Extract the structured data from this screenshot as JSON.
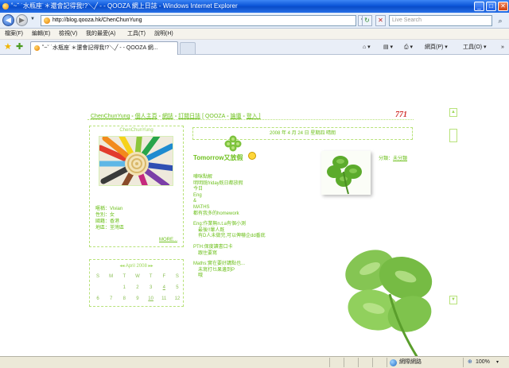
{
  "window": {
    "title": "˚~ˇ ˙水瓶座˙＊還會記得我!?＼╱ - - QOOZA 網上日誌 - Windows Internet Explorer",
    "minimize": "_",
    "maximize": "□",
    "close": "✕"
  },
  "addressbar": {
    "back_glyph": "◀",
    "forward_glyph": "▶",
    "url": "http://blog.qooza.hk/ChenChunYung",
    "dropdown_glyph": "▼",
    "refresh_glyph": "↻",
    "stop_glyph": "✕",
    "search_placeholder": "Live Search",
    "search_glyph": "⌕"
  },
  "menubar": {
    "items": [
      "檔案(F)",
      "編輯(E)",
      "檢視(V)",
      "我的最愛(A)",
      "工具(T)",
      "說明(H)"
    ]
  },
  "tabbar": {
    "active_tab": "˚~ˇ ˙水瓶座˙＊還會記得我!?＼╱ - - QOOZA 網...",
    "tools": {
      "home": "⌂ ▾",
      "feeds": "▤ ▾",
      "print": "⎙ ▾",
      "page": "網頁(P) ▾",
      "tools": "工具(O) ▾",
      "more": "»"
    }
  },
  "blog": {
    "nav": {
      "owner": "ChenChunYung",
      "sep": " - ",
      "home": "個人主頁",
      "diary": "網誌",
      "subscribe": "訂閱日誌",
      "qooza": "[ QOOZA",
      "forum": "論壇",
      "login": "登入 ]"
    },
    "visitor_count": "771",
    "scroll_up": "▲",
    "scroll_down": "▼",
    "profile": {
      "name": "ChenChunYung",
      "info": [
        "暱稱：Vivian",
        "性別：女",
        "國籍：香港",
        "地區：荃灣區"
      ],
      "more": "MORE..."
    },
    "calendar": {
      "title": "◂◂  April 2008  ▸▸",
      "weekdays": [
        "S",
        "M",
        "T",
        "W",
        "T",
        "F",
        "S"
      ],
      "week1": [
        "",
        "",
        "1",
        "2",
        "3",
        "4",
        "5"
      ],
      "week2": [
        "6",
        "7",
        "8",
        "9",
        "10",
        "11",
        "12"
      ]
    },
    "post": {
      "date_line": "2008 年 4 月 24 日 星期四  晴朗",
      "title": "Tomorrow又放假",
      "category_label": "分類：",
      "category_value": "未分類",
      "body": [
        "嘩咪點解",
        "明明既friday既日都放假",
        "今日",
        "Eng",
        "&",
        "MATHS",
        "都有我多的homework",
        "",
        "Eng:作業無n.t.a有個小測",
        "    最後!!暈人既",
        "    有D人未做完,可以俾嚇企dd番底",
        "",
        "PTH:保度讀書口卡",
        "    跟住要寫",
        "",
        "Maths:實在要好講點也...",
        "    未寫打乜果邊到P",
        "    哦"
      ]
    }
  },
  "statusbar": {
    "zone": "網際網路",
    "zoom": "100%"
  },
  "colors": {
    "accent_green": "#6fc11f",
    "title_blue": "#0b55d8",
    "counter_red": "#d0312d"
  }
}
